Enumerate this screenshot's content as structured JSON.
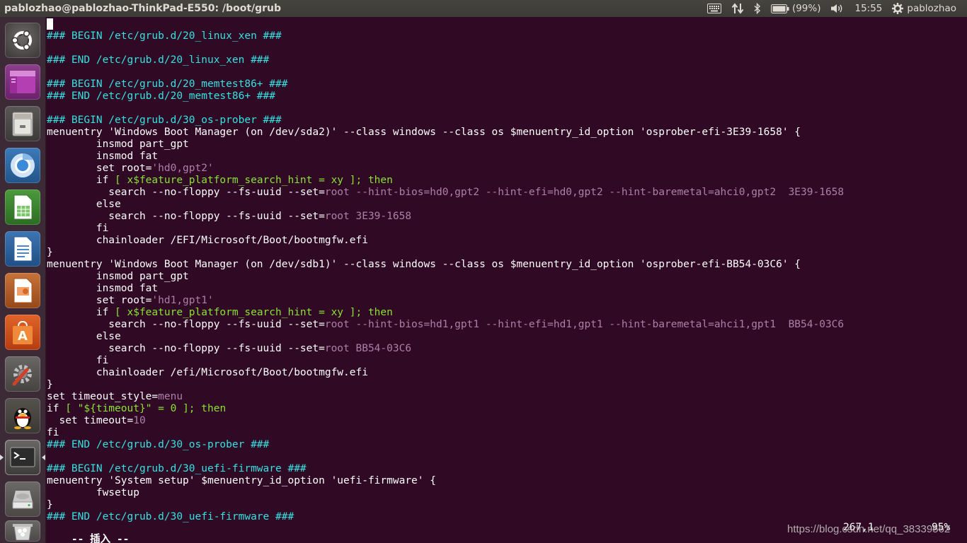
{
  "panel": {
    "title": "pablozhao@pablozhao-ThinkPad-E550: /boot/grub",
    "battery": "(99%)",
    "time": "15:55",
    "user": "pablozhao",
    "icons": [
      "keyboard-icon",
      "network-icon",
      "bluetooth-icon",
      "battery-icon",
      "volume-icon",
      "gear-icon"
    ]
  },
  "launcher": {
    "items": [
      {
        "name": "dash-home",
        "icon": "ubuntu-logo-icon"
      },
      {
        "name": "workspace-switcher",
        "icon": "workspaces-icon"
      },
      {
        "name": "files",
        "icon": "file-cabinet-icon"
      },
      {
        "name": "chromium",
        "icon": "chromium-icon"
      },
      {
        "name": "libreoffice-calc",
        "icon": "spreadsheet-icon"
      },
      {
        "name": "libreoffice-writer",
        "icon": "document-icon"
      },
      {
        "name": "libreoffice-impress",
        "icon": "presentation-icon"
      },
      {
        "name": "software-center",
        "icon": "shopping-bag-icon"
      },
      {
        "name": "system-settings",
        "icon": "settings-wrench-icon"
      },
      {
        "name": "qq",
        "icon": "penguin-icon"
      },
      {
        "name": "terminal",
        "icon": "terminal-icon"
      },
      {
        "name": "disks",
        "icon": "disk-drive-icon"
      },
      {
        "name": "trash",
        "icon": "trash-icon"
      }
    ]
  },
  "terminal": {
    "lines": [
      [],
      [
        [
          "### BEGIN /etc/grub.d/20_linux_xen ###",
          "cyan"
        ]
      ],
      [],
      [
        [
          "### END /etc/grub.d/20_linux_xen ###",
          "cyan"
        ]
      ],
      [],
      [
        [
          "### BEGIN /etc/grub.d/20_memtest86+ ###",
          "cyan"
        ]
      ],
      [
        [
          "### END /etc/grub.d/20_memtest86+ ###",
          "cyan"
        ]
      ],
      [],
      [
        [
          "### BEGIN /etc/grub.d/30_os-prober ###",
          "cyan"
        ]
      ],
      [
        [
          "menuentry 'Windows Boot Manager (on /dev/sda2)' --class windows --class os $menuentry_id_option 'osprober-efi-3E39-1658' {",
          "white"
        ]
      ],
      [
        [
          "        insmod part_gpt",
          "white"
        ]
      ],
      [
        [
          "        insmod fat",
          "white"
        ]
      ],
      [
        [
          "        set root=",
          "white"
        ],
        [
          "'hd0,gpt2'",
          "pink"
        ]
      ],
      [
        [
          "        if ",
          "white"
        ],
        [
          "[ x$feature_platform_search_hint = xy ]; then",
          "green"
        ]
      ],
      [
        [
          "          search --no-floppy --fs-uuid --set=",
          "white"
        ],
        [
          "root --hint-bios=hd0,gpt2 --hint-efi=hd0,gpt2 --hint-baremetal=ahci0,gpt2  3E39-1658",
          "pink"
        ]
      ],
      [
        [
          "        else",
          "white"
        ]
      ],
      [
        [
          "          search --no-floppy --fs-uuid --set=",
          "white"
        ],
        [
          "root 3E39-1658",
          "pink"
        ]
      ],
      [
        [
          "        fi",
          "white"
        ]
      ],
      [
        [
          "        chainloader /EFI/Microsoft/Boot/bootmgfw.efi",
          "white"
        ]
      ],
      [
        [
          "}",
          "white"
        ]
      ],
      [
        [
          "menuentry 'Windows Boot Manager (on /dev/sdb1)' --class windows --class os $menuentry_id_option 'osprober-efi-BB54-03C6' {",
          "white"
        ]
      ],
      [
        [
          "        insmod part_gpt",
          "white"
        ]
      ],
      [
        [
          "        insmod fat",
          "white"
        ]
      ],
      [
        [
          "        set root=",
          "white"
        ],
        [
          "'hd1,gpt1'",
          "pink"
        ]
      ],
      [
        [
          "        if ",
          "white"
        ],
        [
          "[ x$feature_platform_search_hint = xy ]; then",
          "green"
        ]
      ],
      [
        [
          "          search --no-floppy --fs-uuid --set=",
          "white"
        ],
        [
          "root --hint-bios=hd1,gpt1 --hint-efi=hd1,gpt1 --hint-baremetal=ahci1,gpt1  BB54-03C6",
          "pink"
        ]
      ],
      [
        [
          "        else",
          "white"
        ]
      ],
      [
        [
          "          search --no-floppy --fs-uuid --set=",
          "white"
        ],
        [
          "root BB54-03C6",
          "pink"
        ]
      ],
      [
        [
          "        fi",
          "white"
        ]
      ],
      [
        [
          "        chainloader /efi/Microsoft/Boot/bootmgfw.efi",
          "white"
        ]
      ],
      [
        [
          "}",
          "white"
        ]
      ],
      [
        [
          "set timeout_style=",
          "white"
        ],
        [
          "menu",
          "pink"
        ]
      ],
      [
        [
          "if ",
          "white"
        ],
        [
          "[ \"${timeout}\" = 0 ]; then",
          "green"
        ]
      ],
      [
        [
          "  set timeout=",
          "white"
        ],
        [
          "10",
          "pink"
        ]
      ],
      [
        [
          "fi",
          "white"
        ]
      ],
      [
        [
          "### END /etc/grub.d/30_os-prober ###",
          "cyan"
        ]
      ],
      [],
      [
        [
          "### BEGIN /etc/grub.d/30_uefi-firmware ###",
          "cyan"
        ]
      ],
      [
        [
          "menuentry 'System setup' $menuentry_id_option 'uefi-firmware' {",
          "white"
        ]
      ],
      [
        [
          "        fwsetup",
          "white"
        ]
      ],
      [
        [
          "}",
          "white"
        ]
      ],
      [
        [
          "### END /etc/grub.d/30_uefi-firmware ###",
          "cyan"
        ]
      ]
    ],
    "status": {
      "mode": "-- 插入 --",
      "position": "267,1",
      "percent": "95%"
    }
  },
  "watermark": "https://blog.csdn.net/qq_38339562"
}
